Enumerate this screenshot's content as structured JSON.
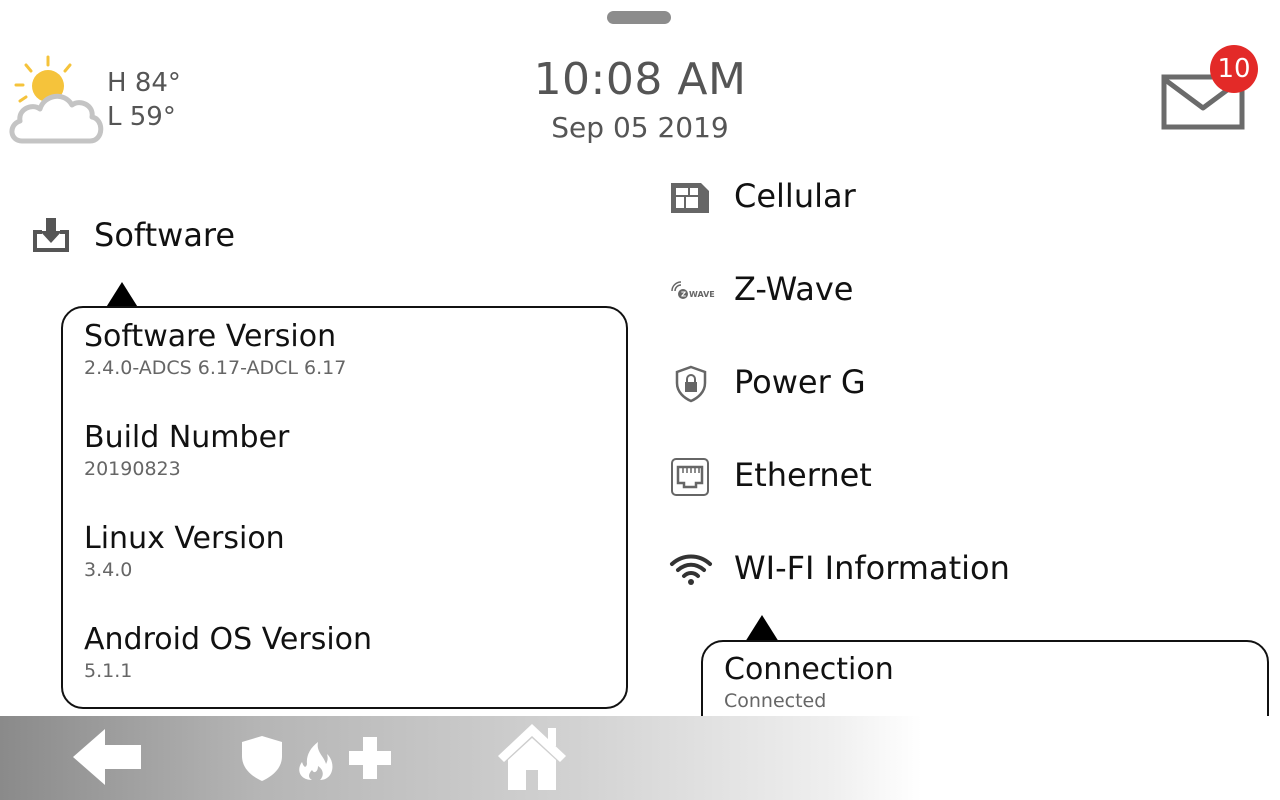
{
  "header": {
    "weather": {
      "icon": "partly-cloudy-icon",
      "high": "H 84°",
      "low": "L 59°"
    },
    "time": "10:08 AM",
    "date": "Sep 05 2019",
    "messages": {
      "icon": "mail-icon",
      "count": "10",
      "badge_color": "#e32a28"
    }
  },
  "software": {
    "label": "Software",
    "icon": "download-tray-icon",
    "details": [
      {
        "title": "Software Version",
        "value": "2.4.0-ADCS 6.17-ADCL 6.17"
      },
      {
        "title": "Build Number",
        "value": "20190823"
      },
      {
        "title": "Linux Version",
        "value": "3.4.0"
      },
      {
        "title": "Android OS Version",
        "value": "5.1.1"
      }
    ]
  },
  "menu": [
    {
      "label": "Cellular",
      "icon": "cellular-icon"
    },
    {
      "label": "Z-Wave",
      "icon": "zwave-icon",
      "icon_text": "WAVE"
    },
    {
      "label": "Power G",
      "icon": "shield-lock-icon"
    },
    {
      "label": "Ethernet",
      "icon": "ethernet-port-icon"
    },
    {
      "label": "WI-FI Information",
      "icon": "wifi-icon"
    }
  ],
  "wifi": {
    "details": [
      {
        "title": "Connection",
        "value": "Connected"
      }
    ]
  },
  "bottom_bar": {
    "items": [
      "back-arrow-icon",
      "emergency-icon",
      "home-icon"
    ]
  }
}
